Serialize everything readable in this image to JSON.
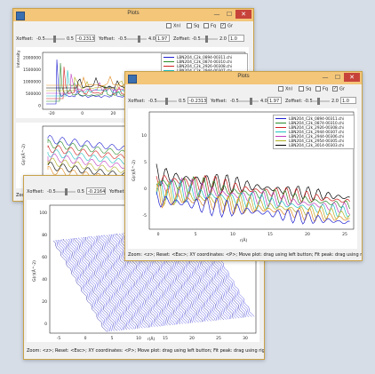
{
  "common": {
    "window_title": "Plots",
    "xoffset_label": "Xoffset:",
    "yoffset_label": "Yoffset:",
    "zoffset_label": "Zoffset:",
    "min_label": "-0.5",
    "xmax_label": "0.5",
    "ymax_label": "4.0",
    "zmax_label": "2.0",
    "chk_xnl": "Xnl",
    "chk_sq": "Sq",
    "chk_fq": "Fq",
    "chk_gr": "Gr",
    "status_text": "Zoom: <z>; Reset: <Esc>; XY coordinates: <P>; Move plot: drag using left button; Fit peak: drag using right button",
    "close_glyph": "✕",
    "min_glyph": "—",
    "max_glyph": "☐",
    "r_axis_label": "r(Å)",
    "gr_axis_label": "G(r)(Å^-2)"
  },
  "win_back": {
    "xoffset_value": "-0.2313",
    "yoffset_value": "1.97",
    "zoffset_value": "1.0",
    "legend": [
      "LBN2O4_C2k_0894-00311.chi",
      "LBN2O4_C2k_0874-00310.chi",
      "LBN2O4_C2k_2926-00308.chi",
      "LBN2O4_C2k_2944-00307.chi",
      "LBN2O4_C2k_2944-00306.chi",
      "LBN2O4_C2k_2954-00305.chi",
      "LBN2O4_C2k_3014-00303.chi"
    ],
    "top_yticks": [
      "2000000",
      "1500000",
      "1000000",
      "500000",
      "0"
    ],
    "top_ylabel": "Intensity",
    "top_xticks": [
      "-20",
      "0",
      "20",
      "40",
      "60",
      "80",
      "100"
    ],
    "bot_ylabel": "G(r)(Å^-2)",
    "bot_xticks": [
      "-5",
      "0",
      "5",
      "10"
    ]
  },
  "win_front": {
    "xoffset_value": "-0.2313",
    "yoffset_value": "1.97",
    "zoffset_value": "1.0",
    "legend": [
      "LBN2O4_C2k_0894-00311.chi",
      "LBN2O4_C2k_0874-00310.chi",
      "LBN2O4_C2k_2926-00308.chi",
      "LBN2O4_C2k_2944-00307.chi",
      "LBN2O4_C2k_2944-00306.chi",
      "LBN2O4_C2k_2954-00305.chi",
      "LBN2O4_C2k_3014-00303.chi"
    ],
    "yticks": [
      "10",
      "5",
      "0",
      "-5"
    ],
    "xticks": [
      "0",
      "5",
      "10",
      "15",
      "20",
      "25"
    ]
  },
  "win_left": {
    "xoffset_value": "-0.2164",
    "yoffset_value": "4.6",
    "yticks": [
      "100",
      "80",
      "60",
      "40",
      "20",
      "0"
    ],
    "xticks": [
      "-5",
      "0",
      "5",
      "10",
      "15",
      "20",
      "25",
      "30"
    ]
  },
  "colors": {
    "series": [
      "#1f1fd0",
      "#2a8a2a",
      "#d02020",
      "#20c0c0",
      "#c040c0",
      "#b0b020",
      "#000000",
      "#e08a20"
    ]
  }
}
